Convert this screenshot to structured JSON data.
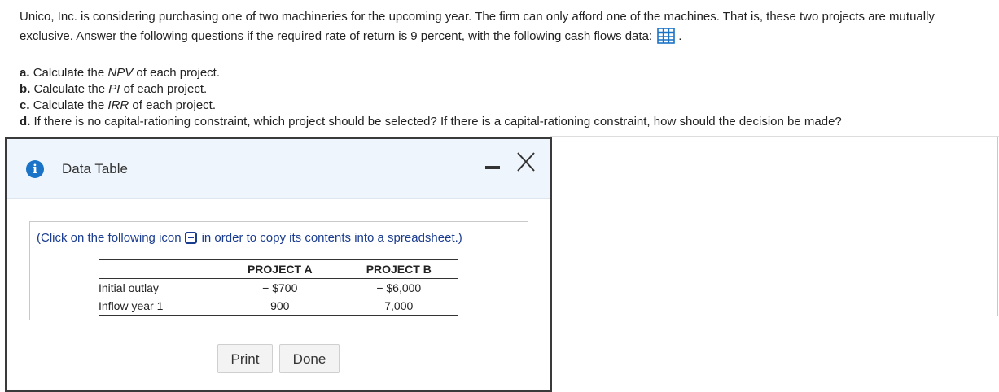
{
  "question": {
    "intro": "Unico, Inc. is considering purchasing one of two machineries for the upcoming year. The firm can only afford one of the machines. That is, these two projects are mutually exclusive. Answer the following questions if the required rate of return is 9 percent, with the following cash flows data:",
    "trailing_period": ".",
    "parts": [
      {
        "letter": "a.",
        "pre": "Calculate the ",
        "em": "NPV",
        "post": " of each project."
      },
      {
        "letter": "b.",
        "pre": "Calculate the ",
        "em": "PI",
        "post": " of each project."
      },
      {
        "letter": "c.",
        "pre": "Calculate the ",
        "em": "IRR",
        "post": " of each project."
      },
      {
        "letter": "d.",
        "pre": "If there is no capital-rationing constraint, which project should be selected? If there is a capital-rationing constraint, how should the decision be made?",
        "em": "",
        "post": ""
      }
    ],
    "data_icon": "table-grid-icon"
  },
  "modal": {
    "title": "Data Table",
    "info_icon": "i",
    "minimize_icon": "minimize-icon",
    "close_icon": "close-icon",
    "copy_note_pre": "(Click on the following icon",
    "copy_note_post": "in order to copy its contents into a spreadsheet.)",
    "table": {
      "headers": [
        "",
        "PROJECT A",
        "PROJECT B"
      ],
      "rows": [
        {
          "label": "Initial outlay",
          "a": "− $700",
          "b": "− $6,000"
        },
        {
          "label": "Inflow year 1",
          "a": "900",
          "b": "7,000"
        }
      ]
    },
    "print_label": "Print",
    "done_label": "Done"
  },
  "colors": {
    "accent_blue": "#1a73c7",
    "link_blue": "#1a3c8f",
    "header_bg": "#eef5fc"
  }
}
